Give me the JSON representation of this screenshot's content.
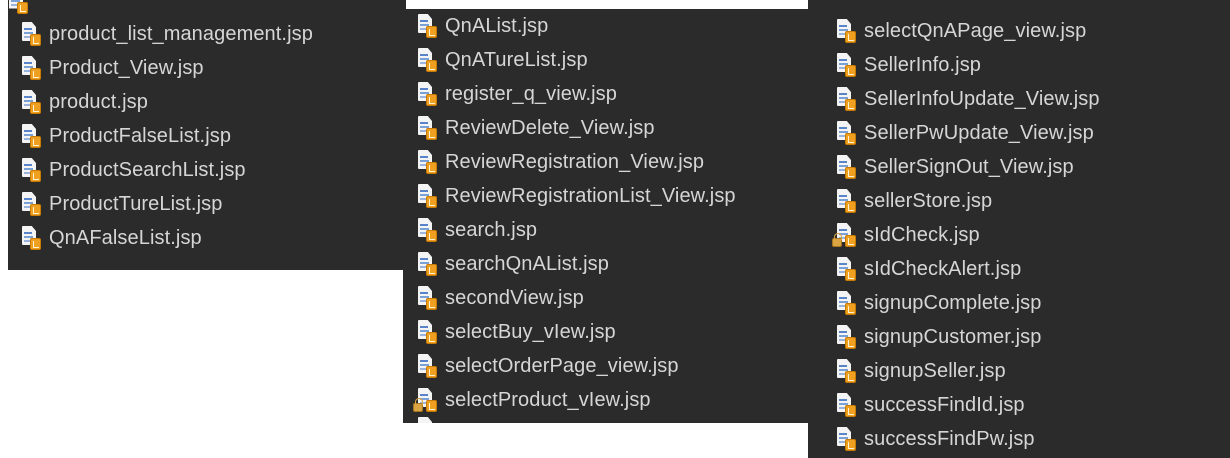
{
  "panels": [
    {
      "files": [
        {
          "name": "product_list_management.jsp",
          "icon": "jsp-file-icon"
        },
        {
          "name": "Product_View.jsp",
          "icon": "jsp-file-icon"
        },
        {
          "name": "product.jsp",
          "icon": "jsp-file-icon"
        },
        {
          "name": "ProductFalseList.jsp",
          "icon": "jsp-file-icon"
        },
        {
          "name": "ProductSearchList.jsp",
          "icon": "jsp-file-icon"
        },
        {
          "name": "ProductTureList.jsp",
          "icon": "jsp-file-icon"
        },
        {
          "name": "QnAFalseList.jsp",
          "icon": "jsp-file-icon"
        }
      ]
    },
    {
      "files": [
        {
          "name": "QnAList.jsp",
          "icon": "jsp-file-icon"
        },
        {
          "name": "QnATureList.jsp",
          "icon": "jsp-file-icon"
        },
        {
          "name": "register_q_view.jsp",
          "icon": "jsp-file-icon"
        },
        {
          "name": "ReviewDelete_View.jsp",
          "icon": "jsp-file-icon"
        },
        {
          "name": "ReviewRegistration_View.jsp",
          "icon": "jsp-file-icon"
        },
        {
          "name": "ReviewRegistrationList_View.jsp",
          "icon": "jsp-file-icon"
        },
        {
          "name": "search.jsp",
          "icon": "jsp-file-icon"
        },
        {
          "name": "searchQnAList.jsp",
          "icon": "jsp-file-icon"
        },
        {
          "name": "secondView.jsp",
          "icon": "jsp-file-icon"
        },
        {
          "name": "selectBuy_vIew.jsp",
          "icon": "jsp-file-icon"
        },
        {
          "name": "selectOrderPage_view.jsp",
          "icon": "jsp-file-icon"
        },
        {
          "name": "selectProduct_vIew.jsp",
          "icon": "jsp-file-locked-icon"
        }
      ]
    },
    {
      "files": [
        {
          "name": "selectQnAPage_view.jsp",
          "icon": "jsp-file-icon"
        },
        {
          "name": "SellerInfo.jsp",
          "icon": "jsp-file-icon"
        },
        {
          "name": "SellerInfoUpdate_View.jsp",
          "icon": "jsp-file-icon"
        },
        {
          "name": "SellerPwUpdate_View.jsp",
          "icon": "jsp-file-icon"
        },
        {
          "name": "SellerSignOut_View.jsp",
          "icon": "jsp-file-icon"
        },
        {
          "name": "sellerStore.jsp",
          "icon": "jsp-file-icon"
        },
        {
          "name": "sIdCheck.jsp",
          "icon": "jsp-file-locked-icon"
        },
        {
          "name": "sIdCheckAlert.jsp",
          "icon": "jsp-file-icon"
        },
        {
          "name": "signupComplete.jsp",
          "icon": "jsp-file-icon"
        },
        {
          "name": "signupCustomer.jsp",
          "icon": "jsp-file-icon"
        },
        {
          "name": "signupSeller.jsp",
          "icon": "jsp-file-icon"
        },
        {
          "name": "successFindId.jsp",
          "icon": "jsp-file-icon"
        },
        {
          "name": "successFindPw.jsp",
          "icon": "jsp-file-icon"
        }
      ]
    }
  ]
}
